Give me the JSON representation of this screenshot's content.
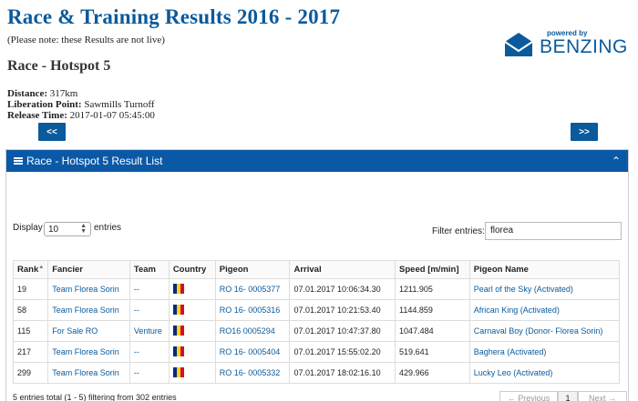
{
  "header": {
    "title": "Race & Training Results 2016 - 2017",
    "note": "(Please note: these Results are not live)"
  },
  "race": {
    "title": "Race - Hotspot 5",
    "distance_label": "Distance:",
    "distance": "317km",
    "liberation_label": "Liberation Point:",
    "liberation": "Sawmills Turnoff",
    "release_label": "Release Time:",
    "release": "2017-01-07 05:45:00"
  },
  "nav": {
    "prev": "<<",
    "next": ">>"
  },
  "panel": {
    "title": "Race - Hotspot 5 Result List",
    "collapse_icon": "chevron-up-icon"
  },
  "logo": {
    "powered": "powered by",
    "brand": "BENZING",
    "brand_color": "#0a5a9c"
  },
  "controls": {
    "display_label": "Display",
    "entries_value": "10",
    "entries_label": "entries",
    "filter_label": "Filter entries:",
    "filter_value": "florea"
  },
  "table": {
    "columns": [
      "Rank",
      "Fancier",
      "Team",
      "Country",
      "Pigeon",
      "Arrival",
      "Speed [m/min]",
      "Pigeon Name"
    ],
    "rows": [
      [
        "19",
        "Team Florea Sorin",
        "--",
        "RO",
        "RO 16- 0005377",
        "07.01.2017 10:06:34.30",
        "1211.905",
        "Pearl of the Sky (Activated)"
      ],
      [
        "58",
        "Team Florea Sorin",
        "--",
        "RO",
        "RO 16- 0005316",
        "07.01.2017 10:21:53.40",
        "1144.859",
        "African King (Activated)"
      ],
      [
        "115",
        "For Sale RO",
        "Venture",
        "RO",
        "RO16 0005294",
        "07.01.2017 10:47:37.80",
        "1047.484",
        "Carnaval Boy (Donor- Florea Sorin)"
      ],
      [
        "217",
        "Team Florea Sorin",
        "--",
        "RO",
        "RO 16- 0005404",
        "07.01.2017 15:55:02.20",
        "519.641",
        "Baghera (Activated)"
      ],
      [
        "299",
        "Team Florea Sorin",
        "--",
        "RO",
        "RO 16- 0005332",
        "07.01.2017 18:02:16.10",
        "429.966",
        "Lucky Leo (Activated)"
      ]
    ]
  },
  "footer": {
    "summary": "5 entries total (1 - 5) filtering from 302 entries",
    "previous": "← Previous",
    "page": "1",
    "next": "Next →"
  },
  "colors": {
    "accent": "#0a5a9c",
    "flag": [
      "#002b7f",
      "#fcd116",
      "#ce1126"
    ]
  }
}
